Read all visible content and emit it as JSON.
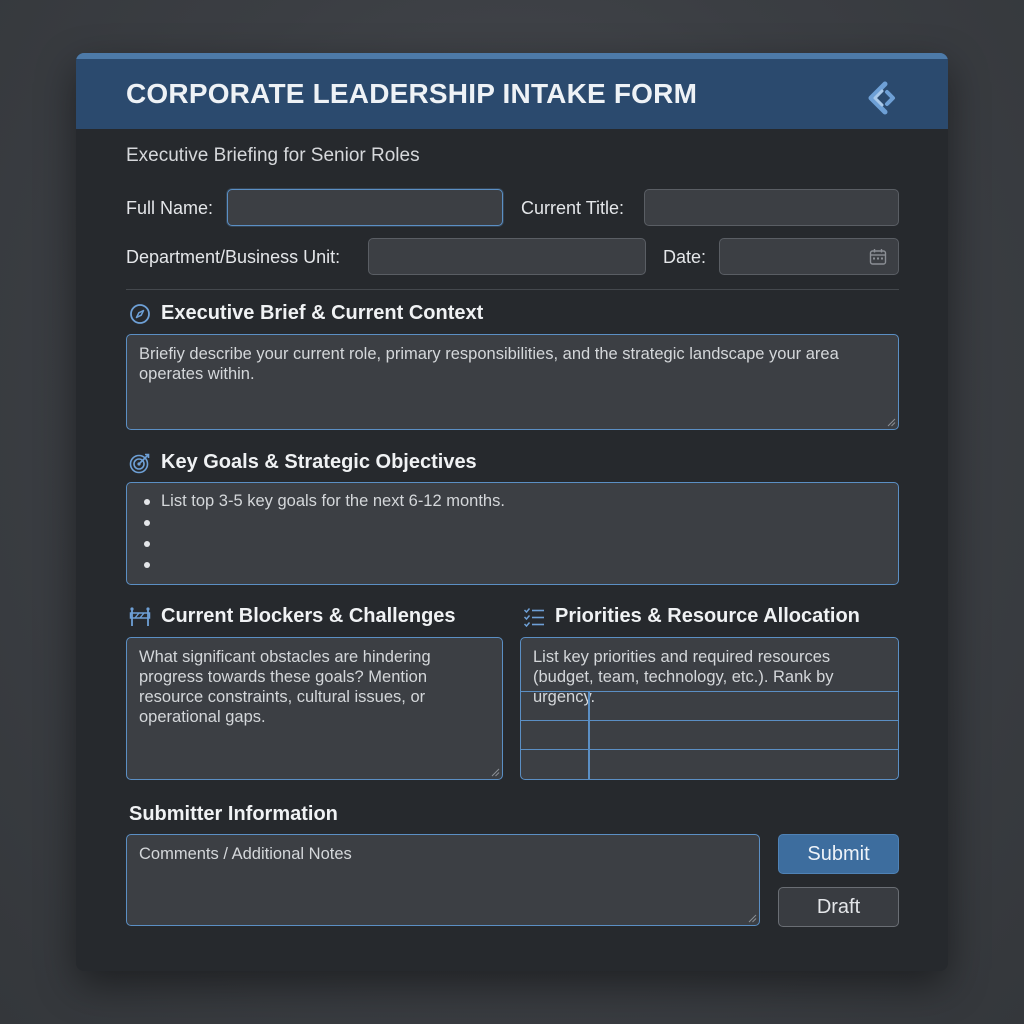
{
  "header": {
    "title": "CORPORATE LEADERSHIP INTAKE FORM"
  },
  "subtitle": "Executive Briefing for Senior Roles",
  "fields": {
    "full_name_label": "Full Name:",
    "current_title_label": "Current Title:",
    "department_label": "Department/Business Unit:",
    "date_label": "Date:"
  },
  "sections": {
    "brief": {
      "title": "Executive Brief & Current Context",
      "placeholder": "Briefiy describe your current role, primary responsibilities, and the strategic landscape your area operates within."
    },
    "goals": {
      "title": "Key Goals & Strategic Objectives",
      "bullets": [
        "List top 3-5 key goals for the next 6-12 months.",
        "",
        "",
        ""
      ]
    },
    "blockers": {
      "title": "Current Blockers & Challenges",
      "placeholder": "What significant obstacles are hindering progress towards these goals? Mention resource constraints, cultural issues, or operational gaps."
    },
    "priorities": {
      "title": "Priorities & Resource Allocation",
      "placeholder": "List key priorities and required resources (budget, team, technology, etc.). Rank by urgency."
    },
    "submitter": {
      "title": "Submitter Information",
      "comments_placeholder": "Comments / Additional Notes"
    }
  },
  "buttons": {
    "submit": "Submit",
    "draft": "Draft"
  },
  "icons": {
    "logo": "brand-logo-icon",
    "date": "calendar-icon",
    "brief": "compass-icon",
    "goals": "target-icon",
    "blockers": "barrier-icon",
    "priorities": "checklist-icon"
  },
  "colors": {
    "accent": "#5b8fc4",
    "header_bg": "#2b4a6e",
    "card_bg": "#26292d",
    "field_bg": "#3c3f44",
    "submit_bg": "#3d6d9e"
  }
}
